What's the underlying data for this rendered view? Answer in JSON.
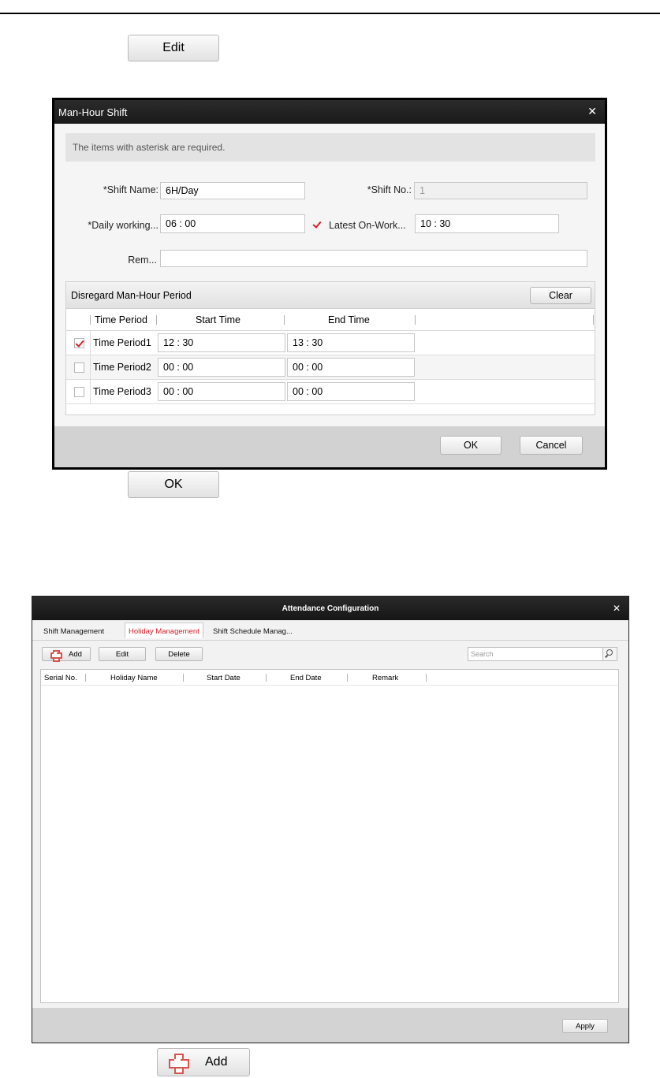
{
  "doc": {
    "edit_button": "Edit",
    "ok_button": "OK",
    "add_button": "Add"
  },
  "man_hour_dialog": {
    "title": "Man-Hour Shift",
    "notice": "The items with asterisk are required.",
    "shift_name_label": "*Shift Name:",
    "shift_name_value": "6H/Day",
    "shift_no_label": "*Shift No.:",
    "shift_no_value": "1",
    "daily_working_label": "*Daily working...",
    "daily_working_value": "06 : 00",
    "latest_on_work_label": "Latest On-Work...",
    "latest_on_work_checked": true,
    "latest_on_work_value": "10 : 30",
    "remark_label": "Rem...",
    "remark_value": "",
    "period_section_title": "Disregard Man-Hour Period",
    "clear_button": "Clear",
    "columns": [
      "Time Period",
      "Start Time",
      "End Time"
    ],
    "periods": [
      {
        "name": "Time Period1",
        "checked": true,
        "start": "12 : 30",
        "end": "13 : 30"
      },
      {
        "name": "Time Period2",
        "checked": false,
        "start": "00 : 00",
        "end": "00 : 00"
      },
      {
        "name": "Time Period3",
        "checked": false,
        "start": "00 : 00",
        "end": "00 : 00"
      }
    ],
    "ok_button": "OK",
    "cancel_button": "Cancel"
  },
  "attendance_dialog": {
    "title": "Attendance Configuration",
    "tabs": [
      "Shift Management",
      "Holiday Management",
      "Shift Schedule Manag..."
    ],
    "active_tab": "Holiday Management",
    "toolbar": {
      "add": "Add",
      "edit": "Edit",
      "delete": "Delete"
    },
    "search_placeholder": "Search",
    "columns": [
      "Serial No.",
      "Holiday Name",
      "Start Date",
      "End Date",
      "Remark"
    ],
    "apply_button": "Apply"
  },
  "colors": {
    "accent_red": "#d0202a",
    "titlebar": "#1f1f1f"
  }
}
